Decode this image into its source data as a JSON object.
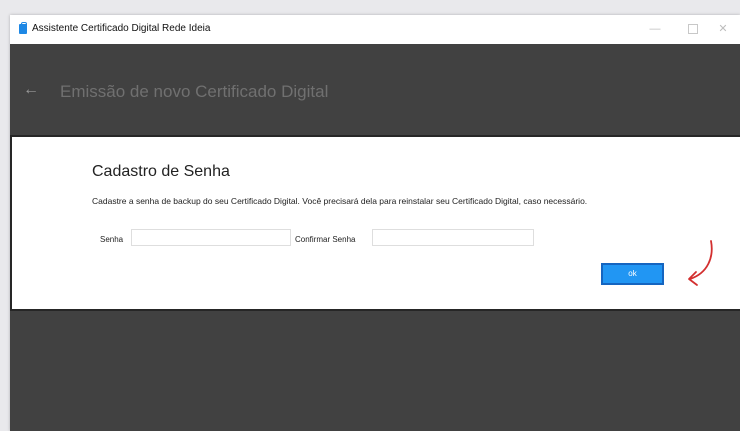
{
  "window": {
    "title": "Assistente Certificado Digital Rede Ideia",
    "controls": [
      "—",
      "☐",
      "✕"
    ]
  },
  "header": {
    "back_icon": "←",
    "title": "Emissão de novo Certificado Digital"
  },
  "dialog": {
    "title": "Cadastro de Senha",
    "description": "Cadastre a senha de backup do seu Certificado Digital. Você precisará dela para reinstalar seu Certificado Digital, caso necessário.",
    "password_label": "Senha",
    "password_value": "",
    "confirm_label": "Confirmar Senha",
    "confirm_value": "",
    "ok_label": "ok"
  },
  "colors": {
    "accent": "#2196f3",
    "annotation_arrow": "#d32f2f",
    "background_dark": "#414141"
  },
  "icons": [
    "app-icon",
    "back-arrow-icon",
    "minimize-icon",
    "maximize-icon",
    "close-icon",
    "red-arrow-icon"
  ]
}
